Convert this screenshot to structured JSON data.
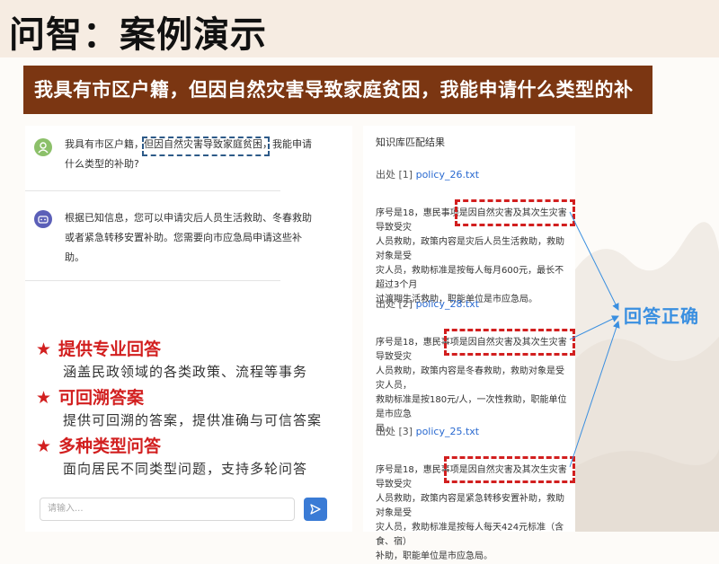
{
  "slide": {
    "title": "问智：案例演示",
    "question": "我具有市区户籍，但因自然灾害导致家庭贫困，我能申请什么类型的补助？"
  },
  "chat": {
    "user_message": "我具有市区户籍，但因自然灾害导致家庭贫困，我能申请什么类型的补助?",
    "user_lines": [
      "我具有市区户籍，但因自然灾害导致家庭贫困，我能申请",
      "什么类型的补助?"
    ],
    "bot_lines": [
      "根据已知信息，您可以申请灾后人员生活救助、冬春救助",
      "或者紧急转移安置补助。您需要向市应急局申请这些补",
      "助。"
    ],
    "input_placeholder": "请输入...",
    "user_avatar_color": "#8cc06a",
    "bot_avatar_color": "#5b5fb8"
  },
  "features": [
    {
      "title": "提供专业回答",
      "desc": "涵盖民政领域的各类政策、流程等事务"
    },
    {
      "title": "可回溯答案",
      "desc": "提供可回溯的答案，提供准确与可信答案"
    },
    {
      "title": "多种类型问答",
      "desc": "面向居民不同类型问题，支持多轮问答"
    }
  ],
  "feature_star": "★",
  "knowledge": {
    "title": "知识库匹配结果",
    "source_prefix": "出处",
    "sources": [
      {
        "index": "[1]",
        "file": "policy_26.txt",
        "lines": [
          "序号是18，惠民事项是因自然灾害及其次生灾害导致受灾",
          "人员救助，政策内容是灾后人员生活救助，救助对象是受",
          "灾人员，救助标准是按每人每月600元，最长不超过3个月",
          "过渡期生活救助，职能单位是市应急局。"
        ]
      },
      {
        "index": "[2]",
        "file": "policy_28.txt",
        "lines": [
          "序号是18，惠民事项是因自然灾害及其次生灾害导致受灾",
          "人员救助，政策内容是冬春救助，救助对象是受灾人员，",
          "救助标准是按180元/人，一次性救助，职能单位是市应急",
          "局。"
        ]
      },
      {
        "index": "[3]",
        "file": "policy_25.txt",
        "lines": [
          "序号是18，惠民事项是因自然灾害及其次生灾害导致受灾",
          "人员救助，政策内容是紧急转移安置补助，救助对象是受",
          "灾人员，救助标准是按每人每天424元标准（含食、宿）",
          "补助，职能单位是市应急局。"
        ]
      }
    ]
  },
  "annotation": {
    "correct_label": "回答正确",
    "accent_red": "#d21f1f",
    "accent_blue": "#3a8fe0",
    "question_bar_color": "#7b3612"
  }
}
